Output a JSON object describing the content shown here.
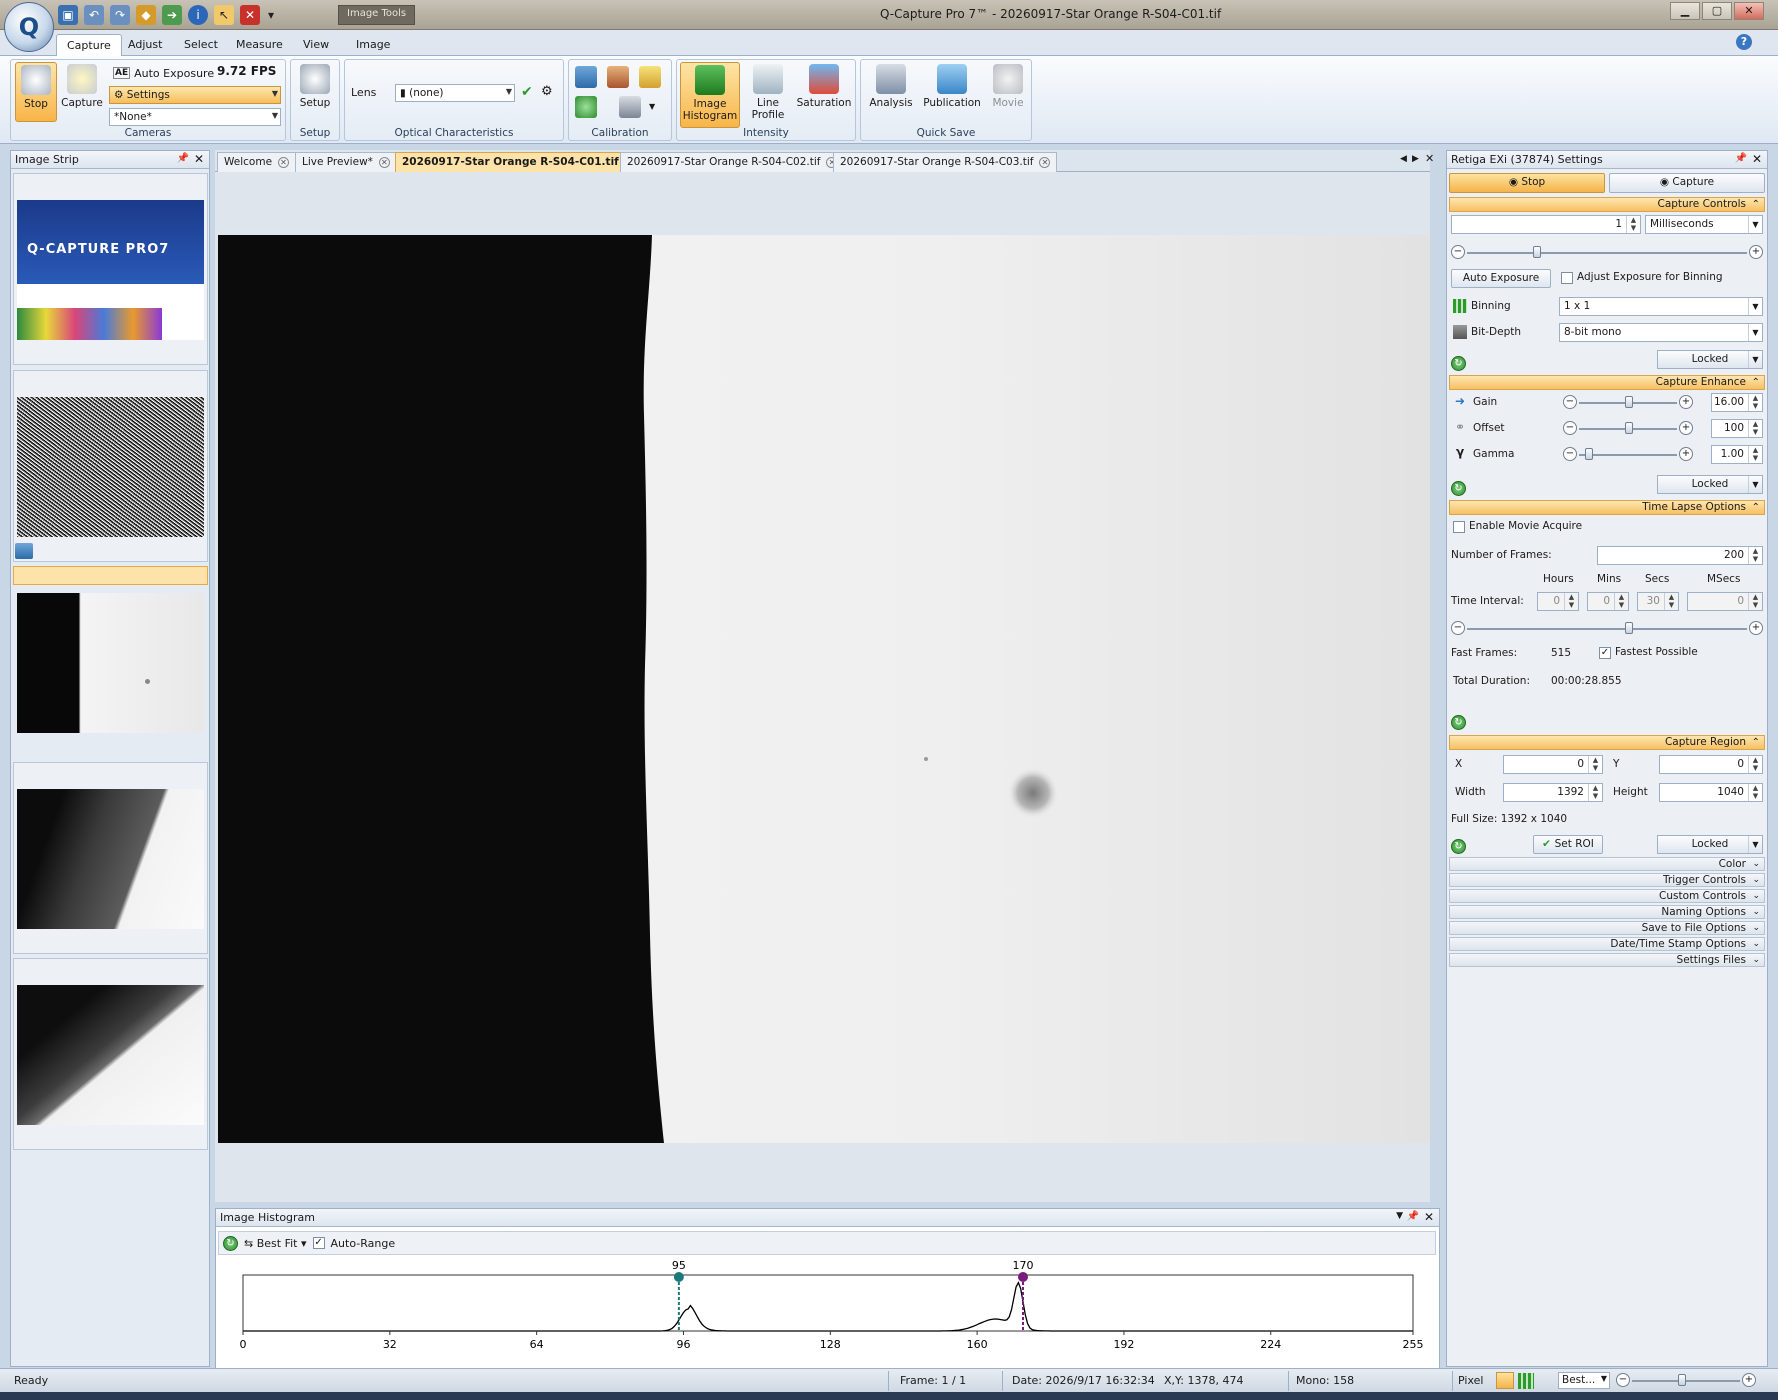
{
  "app": {
    "title": "Q-Capture Pro 7™ - 20260917-Star Orange R-S04-C01.tif",
    "context_tab": "Image Tools",
    "logo_letter": "Q"
  },
  "ribbon_tabs": [
    "Capture",
    "Adjust",
    "Select",
    "Measure",
    "View",
    "Image"
  ],
  "ribbon": {
    "cameras": {
      "stop_label": "Stop",
      "capture_label": "Capture",
      "auto_exposure": "Auto Exposure",
      "fps": "9.72 FPS",
      "settings": "Settings",
      "preset": "*None*",
      "group": "Cameras"
    },
    "setup": {
      "button": "Setup",
      "group": "Setup"
    },
    "optical": {
      "lens_label": "Lens",
      "lens_value": "(none)",
      "group": "Optical Characteristics"
    },
    "calibration": {
      "group": "Calibration"
    },
    "intensity": {
      "histogram": "Image Histogram",
      "line_profile": "Line Profile",
      "saturation": "Saturation",
      "group": "Intensity"
    },
    "quicksave": {
      "analysis": "Analysis",
      "publication": "Publication",
      "movie": "Movie",
      "group": "Quick Save"
    }
  },
  "image_strip": {
    "title": "Image Strip",
    "splash_title": "Q-CAPTURE PRO7"
  },
  "doc_tabs": [
    {
      "label": "Welcome",
      "active": false
    },
    {
      "label": "Live Preview*",
      "active": false
    },
    {
      "label": "20260917-Star Orange R-S04-C01.tif",
      "active": true
    },
    {
      "label": "20260917-Star Orange R-S04-C02.tif",
      "active": false
    },
    {
      "label": "20260917-Star Orange R-S04-C03.tif",
      "active": false
    }
  ],
  "histogram": {
    "title": "Image Histogram",
    "fit": "Best Fit",
    "auto_range": "Auto-Range",
    "marker_low": "95",
    "marker_high": "170",
    "ticks": [
      "0",
      "32",
      "64",
      "96",
      "128",
      "160",
      "192",
      "224",
      "255"
    ],
    "low_color": "#1a7a7a",
    "high_color": "#7a1a7a"
  },
  "settings": {
    "title": "Retiga EXi (37874) Settings",
    "stop": "Stop",
    "capture": "Capture",
    "capture_controls": {
      "header": "Capture Controls",
      "exposure_value": "1",
      "exposure_unit": "Milliseconds",
      "auto_exposure": "Auto Exposure",
      "adjust_binning": "Adjust Exposure for Binning",
      "binning_label": "Binning",
      "binning_value": "1 x 1",
      "bitdepth_label": "Bit-Depth",
      "bitdepth_value": "8-bit mono",
      "locked": "Locked"
    },
    "capture_enhance": {
      "header": "Capture Enhance",
      "gain_label": "Gain",
      "gain_value": "16.00",
      "offset_label": "Offset",
      "offset_value": "100",
      "gamma_label": "Gamma",
      "gamma_value": "1.00",
      "locked": "Locked"
    },
    "time_lapse": {
      "header": "Time Lapse Options",
      "enable_movie": "Enable Movie Acquire",
      "frames_label": "Number of  Frames:",
      "frames_value": "200",
      "col_hours": "Hours",
      "col_mins": "Mins",
      "col_secs": "Secs",
      "col_msecs": "MSecs",
      "interval_label": "Time Interval:",
      "hours": "0",
      "mins": "0",
      "secs": "30",
      "msecs": "0",
      "fast_frames_label": "Fast Frames:",
      "fast_frames_value": "515",
      "fastest_possible": "Fastest Possible",
      "duration_label": "Total Duration:",
      "duration_value": "00:00:28.855"
    },
    "capture_region": {
      "header": "Capture Region",
      "x_label": "X",
      "x_value": "0",
      "y_label": "Y",
      "y_value": "0",
      "width_label": "Width",
      "width_value": "1392",
      "height_label": "Height",
      "height_value": "1040",
      "full_size": "Full Size: 1392 x 1040",
      "set_roi": "Set ROI",
      "locked": "Locked"
    },
    "collapsed": [
      "Color",
      "Trigger Controls",
      "Custom Controls",
      "Naming Options",
      "Save to File Options",
      "Date/Time Stamp Options",
      "Settings Files"
    ]
  },
  "status": {
    "ready": "Ready",
    "frame": "Frame: 1 / 1",
    "date": "Date: 2026/9/17 16:32:34",
    "xy": "X,Y: 1378,  474",
    "mono": "Mono:   158",
    "pixel": "Pixel",
    "zoom": "Best..."
  }
}
